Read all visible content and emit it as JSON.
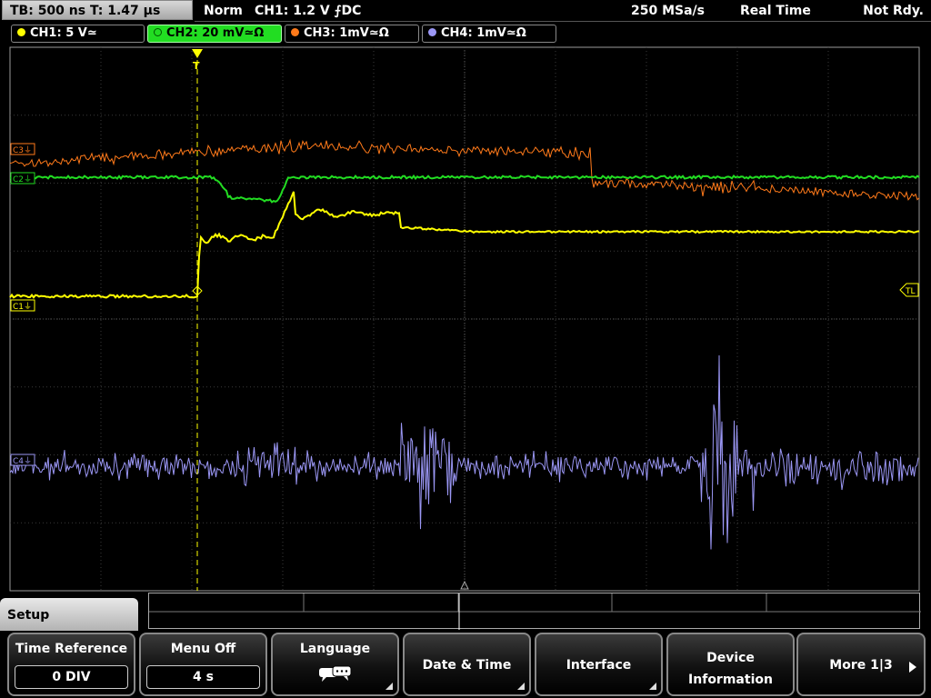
{
  "status": {
    "timebase": "TB: 500 ns   T: 1.47 µs",
    "mode": "Norm",
    "trigger": "CH1: 1.2 V ⨍DC",
    "sample_rate": "250 MSa/s",
    "acquisition": "Real Time",
    "state": "Not Rdy."
  },
  "channels": [
    {
      "label": "CH1: 5 V≃",
      "color": "#ffff00",
      "active": false
    },
    {
      "label": "CH2: 20 mV≃Ω",
      "color": "#22dd22",
      "active": true
    },
    {
      "label": "CH3: 1mV≃Ω",
      "color": "#ff7a1a",
      "active": false
    },
    {
      "label": "CH4: 1mV≃Ω",
      "color": "#9b97f5",
      "active": false
    }
  ],
  "markers": {
    "c3": "C3⏚",
    "c1": "C1⏚",
    "c2": "C2⏚",
    "c4": "C4⏚",
    "trigger_level": "TL",
    "trigger_position": "T"
  },
  "menu": {
    "title": "Setup",
    "softkeys": [
      {
        "label": "Time Reference",
        "value": "0 DIV"
      },
      {
        "label": "Menu Off",
        "value": "4 s"
      },
      {
        "label": "Language",
        "icon": "speech-bubbles-icon"
      },
      {
        "label": "Date & Time"
      },
      {
        "label": "Interface"
      },
      {
        "label": "Device\nInformation"
      },
      {
        "label": "More 1|3"
      }
    ]
  }
}
